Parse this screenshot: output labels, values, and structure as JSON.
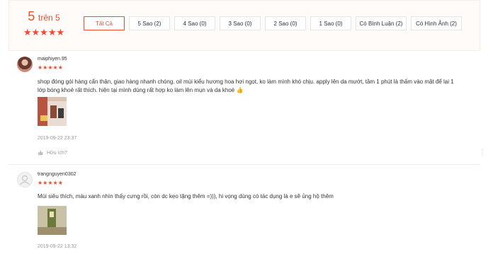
{
  "summary": {
    "score": "5",
    "score_suffix": "trên 5",
    "stars": "★★★★★"
  },
  "filters": [
    {
      "label": "Tất Cả",
      "active": true
    },
    {
      "label": "5 Sao (2)"
    },
    {
      "label": "4 Sao (0)"
    },
    {
      "label": "3 Sao (0)"
    },
    {
      "label": "2 Sao (0)"
    },
    {
      "label": "1 Sao (0)"
    },
    {
      "label": "Có Bình Luận (2)"
    },
    {
      "label": "Có Hình Ảnh (2)"
    }
  ],
  "reviews": [
    {
      "username": "maiphiyen.95",
      "stars": "★★★★★",
      "text": "shop đóng gói hàng cẩn thận, giao hàng nhanh chóng. oil mùi kiểu hương hoa hơi ngọt, ko làm mình khó chịu. apply lên da mướt, tầm 1 phút là thấm vào mặt để lại 1 lớp bóng khoẻ rất thích. hiện tại mình dùng rất hợp ko làm lên mụn và da khoẻ 👍",
      "date": "2019-09-22 23:37",
      "helpful_label": "Hữu ích?"
    },
    {
      "username": "trangnguyen0302",
      "stars": "★★★★★",
      "text": "Mùi siêu thích, màu xanh nhìn thấy cưng rồi, còn dc kẹo tặng thêm =))), hi vọng dùng có tác dụng là e sẽ ủng hộ thêm",
      "date": "2019-09-22 13:32"
    }
  ],
  "colors": {
    "accent": "#ee4d2d"
  },
  "icons": {
    "like": "thumbs-up-icon",
    "more": "more-options-icon",
    "default_avatar": "user-icon"
  }
}
